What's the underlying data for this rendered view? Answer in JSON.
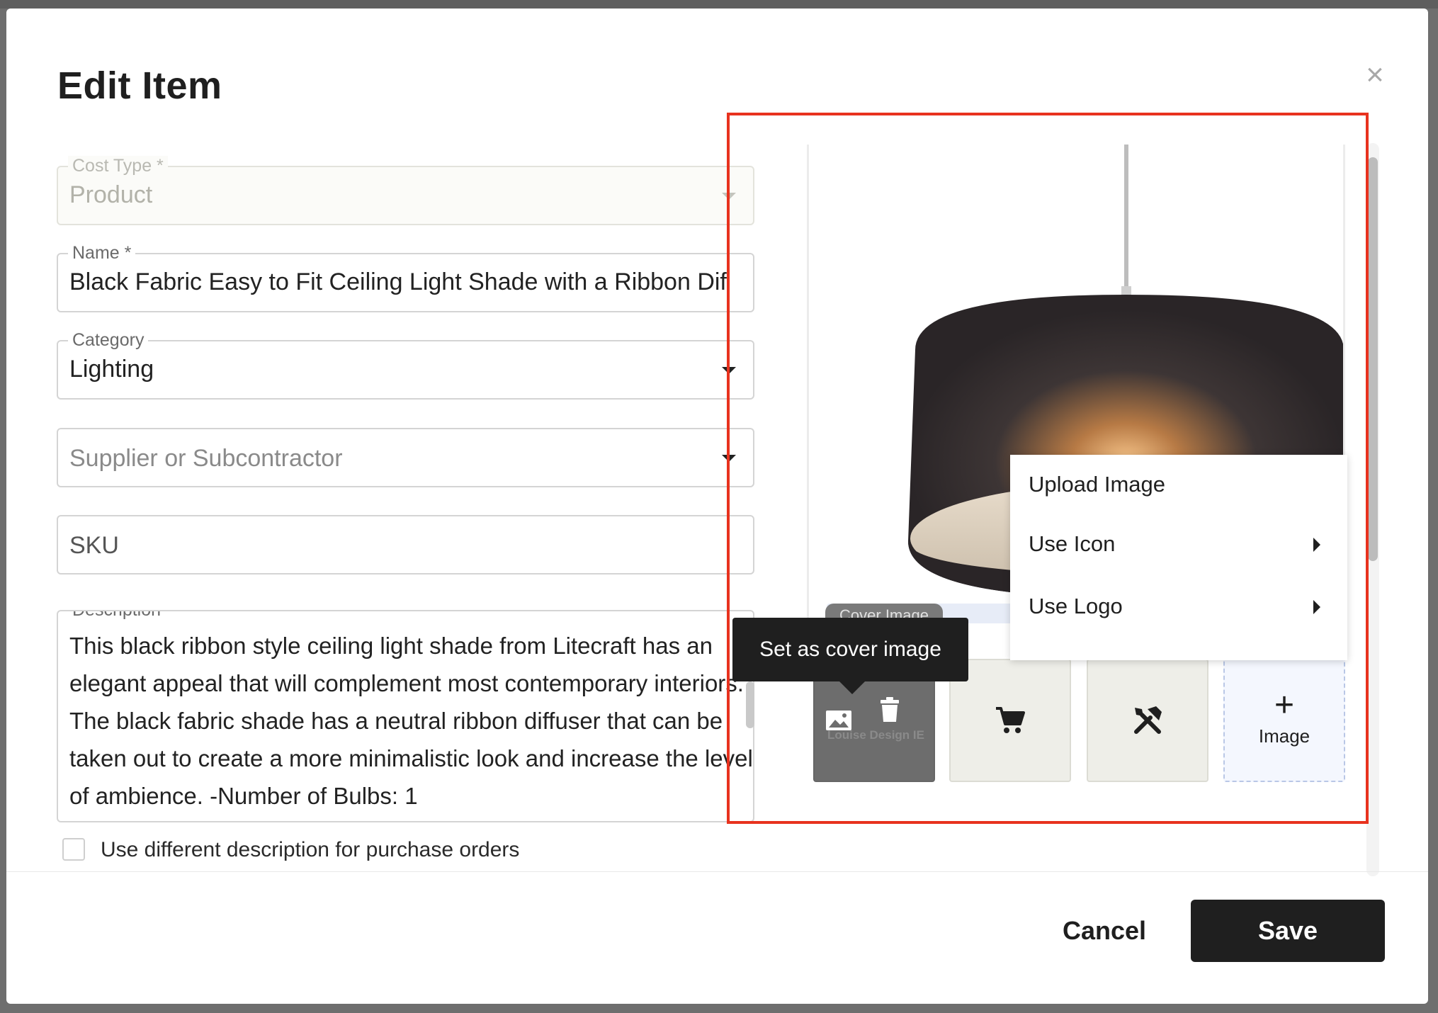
{
  "modal": {
    "title": "Edit Item",
    "close_glyph": "×"
  },
  "fields": {
    "cost_type": {
      "label": "Cost Type *",
      "value": "Product"
    },
    "name": {
      "label": "Name *",
      "value": "Black Fabric Easy to Fit Ceiling Light Shade with a Ribbon Dif"
    },
    "category": {
      "label": "Category",
      "value": "Lighting"
    },
    "supplier": {
      "placeholder": "Supplier or Subcontractor"
    },
    "sku": {
      "placeholder": "SKU"
    },
    "description": {
      "label": "Description",
      "value": "This black ribbon style ceiling light shade from Litecraft has an elegant appeal that will complement most contemporary interiors. The black fabric shade has a neutral ribbon diffuser that can be taken out to create a more minimalistic look and increase the level of ambience. -Number of Bulbs: 1"
    }
  },
  "checkbox": {
    "label": "Use different description for purchase orders",
    "checked": false
  },
  "image_panel": {
    "cover_tab_label": "Cover Image",
    "tooltip": "Set as cover image",
    "cover_thumb_logo_text": "Louise Design IE",
    "add_image_plus": "+",
    "add_image_label": "Image",
    "menu": {
      "upload": "Upload Image",
      "use_icon": "Use Icon",
      "use_logo": "Use Logo"
    }
  },
  "footer": {
    "cancel": "Cancel",
    "save": "Save"
  },
  "colors": {
    "highlight": "#e8321e",
    "primary_button": "#1f1f1f",
    "thumb_bg": "#eeeee8",
    "add_thumb_bg": "#f4f7fe"
  },
  "icons": [
    "close-icon",
    "dropdown-caret-icon",
    "image-icon",
    "trash-icon",
    "cart-icon",
    "tools-icon",
    "plus-icon",
    "chevron-right-icon"
  ]
}
